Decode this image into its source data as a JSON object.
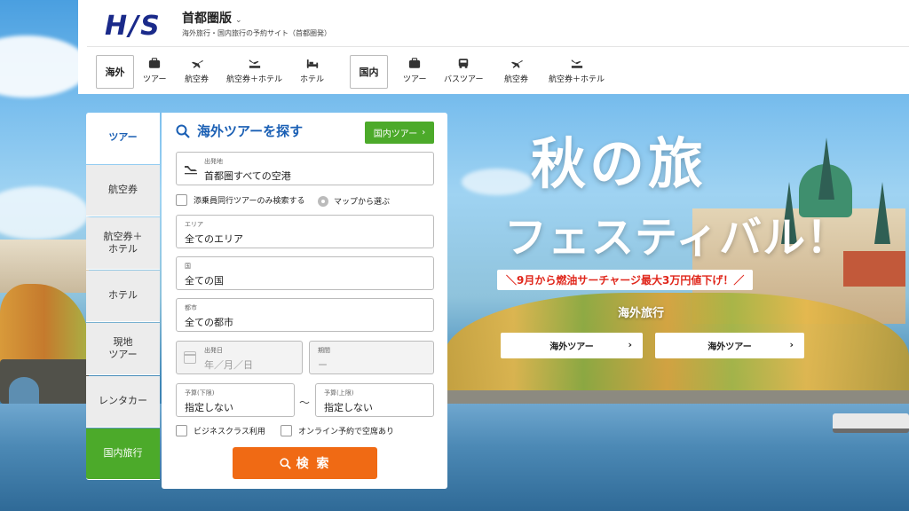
{
  "header": {
    "logo": "H/S",
    "region": "首都圏版",
    "region_chevron": "⌄",
    "tagline": "海外旅行・国内旅行の予約サイト（首都圏発）"
  },
  "nav": {
    "overseas_tab": "海外",
    "overseas_items": [
      {
        "label": "ツアー",
        "icon": "suitcase-icon"
      },
      {
        "label": "航空券",
        "icon": "plane-icon"
      },
      {
        "label": "航空券＋ホテル",
        "icon": "plane-bed-icon"
      },
      {
        "label": "ホテル",
        "icon": "bed-icon"
      }
    ],
    "domestic_tab": "国内",
    "domestic_items": [
      {
        "label": "ツアー",
        "icon": "suitcase-icon"
      },
      {
        "label": "バスツアー",
        "icon": "bus-icon"
      },
      {
        "label": "航空券",
        "icon": "plane-icon"
      },
      {
        "label": "航空券＋ホテル",
        "icon": "plane-bed-icon"
      }
    ]
  },
  "side_tabs": [
    "ツアー",
    "航空券",
    "航空券＋\nホテル",
    "ホテル",
    "現地\nツアー",
    "レンタカー",
    "国内旅行"
  ],
  "search": {
    "title": "海外ツアーを探す",
    "domestic_button": "国内ツアー",
    "departure_label": "出発地",
    "departure_value": "首都圏すべての空港",
    "escort_only": "添乗員同行ツアーのみ検索する",
    "map_select": "マップから選ぶ",
    "area_label": "エリア",
    "area_value": "全てのエリア",
    "country_label": "国",
    "country_value": "全ての国",
    "city_label": "都市",
    "city_value": "全ての都市",
    "date_label": "出発日",
    "date_placeholder": "年／月／日",
    "period_label": "期間",
    "period_placeholder": "ー",
    "budget_min_label": "予算(下限)",
    "budget_min_value": "指定しない",
    "tilde": "～",
    "budget_max_label": "予算(上限)",
    "budget_max_value": "指定しない",
    "business_class": "ビジネスクラス利用",
    "online_booking": "オンライン予約で空席あり",
    "search_button": "検 索"
  },
  "promo": {
    "title": "秋の旅",
    "subtitle": "フェスティバル！",
    "note": "＼9月から燃油サーチャージ最大3万円値下げ！／",
    "label": "海外旅行",
    "buttons": [
      "海外ツアー",
      "海外ツアー"
    ],
    "arrow": "›"
  },
  "colors": {
    "brand_blue": "#1a5fb4",
    "logo_navy": "#1a2a8a",
    "green": "#4caa2a",
    "search_orange": "#f06a14",
    "note_red": "#e0261b"
  }
}
